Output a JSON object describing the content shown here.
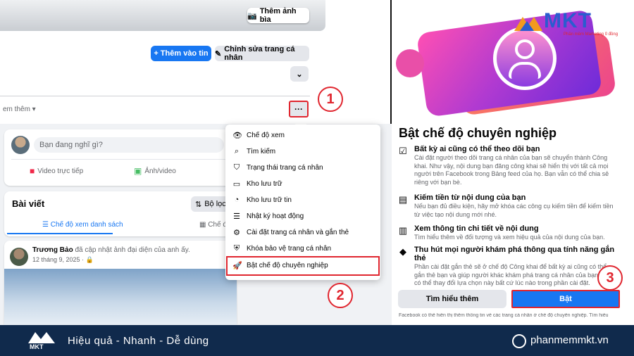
{
  "left": {
    "cover_button": "Thêm ảnh bìa",
    "add_story": "+ Thêm vào tin",
    "edit_profile": "Chỉnh sửa trang cá nhân",
    "see_more": "em thêm ▾",
    "more_dots": "···",
    "composer_placeholder": "Bạn đang nghĩ gì?",
    "live_video": "Video trực tiếp",
    "photo_video": "Ảnh/video",
    "posts_title": "Bài viết",
    "filter_label": "Bộ lọc",
    "list_view": "Chế độ xem danh sách",
    "grid_view": "Chế độ",
    "post_author": "Trương Bảo",
    "post_action": " đã cập nhật ảnh đại diện của anh ấy.",
    "post_date": "12 tháng 9, 2025 · 🔒"
  },
  "menu": {
    "items": [
      {
        "label": "Chế độ xem",
        "icon": "eye-icon"
      },
      {
        "label": "Tìm kiếm",
        "icon": "search-icon"
      },
      {
        "label": "Trạng thái trang cá nhân",
        "icon": "shield-icon"
      },
      {
        "label": "Kho lưu trữ",
        "icon": "archive-icon"
      },
      {
        "label": "Kho lưu trữ tin",
        "icon": "story-archive-icon"
      },
      {
        "label": "Nhật ký hoạt động",
        "icon": "activity-log-icon"
      },
      {
        "label": "Cài đặt trang cá nhân và gắn thẻ",
        "icon": "settings-icon"
      },
      {
        "label": "Khóa bảo vệ trang cá nhân",
        "icon": "lock-shield-icon"
      },
      {
        "label": "Bật chế độ chuyên nghiệp",
        "icon": "rocket-icon"
      }
    ]
  },
  "steps": {
    "one": "1",
    "two": "2",
    "three": "3"
  },
  "right": {
    "logo_text": "MKT",
    "logo_sub": "Phần mềm Marketing 0 đồng",
    "title": "Bật chế độ chuyên nghiệp",
    "features": [
      {
        "title": "Bất kỳ ai cũng có thể theo dõi bạn",
        "desc": "Cài đặt người theo dõi trang cá nhân của bạn sẽ chuyển thành Công khai. Như vậy, nội dung bạn đăng công khai sẽ hiển thị với tất cả mọi người trên Facebook trong Bảng feed của họ. Bạn vẫn có thể chia sẻ riêng với bạn bè."
      },
      {
        "title": "Kiếm tiền từ nội dung của bạn",
        "desc": "Nếu bạn đủ điều kiện, hãy mở khóa các công cụ kiếm tiền để kiếm tiền từ việc tạo nội dung mới nhé."
      },
      {
        "title": "Xem thông tin chi tiết về nội dung",
        "desc": "Tìm hiểu thêm về đối tượng và xem hiệu quả của nội dung của bạn."
      },
      {
        "title": "Thu hút mọi người khám phá thông qua tính năng gắn thẻ",
        "desc": "Phần cài đặt gắn thẻ sẽ ở chế độ Công khai để bất kỳ ai cũng có thể gắn thẻ bạn và giúp người khác khám phá trang cá nhân của bạn. Bạn có thể thay đổi lựa chọn này bất cứ lúc nào trong phần cài đặt."
      }
    ],
    "learn_more": "Tìm hiểu thêm",
    "turn_on": "Bật",
    "footnote": "Facebook có thể hiển thị thêm thông tin về các trang cá nhân ở chế độ chuyên nghiệp. Tìm hiểu"
  },
  "footer": {
    "tagline": "Hiệu quả - Nhanh - Dễ dùng",
    "site": "phanmemmkt.vn",
    "logo_text": "MKT"
  },
  "colors": {
    "accent": "#1877f2",
    "highlight": "#e0262f",
    "footer_bg": "#102a4c"
  }
}
